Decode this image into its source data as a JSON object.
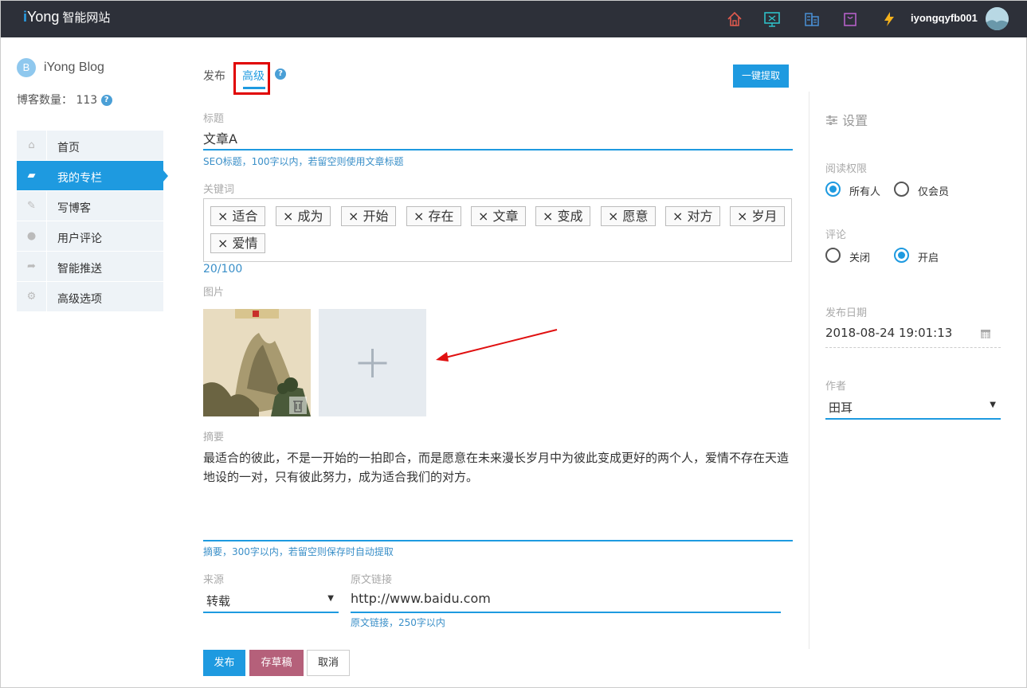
{
  "app": {
    "logo_i": "i",
    "logo_yong": "Yong",
    "logo_sub": "智能网站",
    "username": "iyongqyfb001"
  },
  "blog": {
    "initial": "B",
    "name": "iYong Blog",
    "count_label": "博客数量：",
    "count": "113"
  },
  "sidebar": {
    "items": [
      {
        "label": "首页",
        "icon": "home-icon"
      },
      {
        "label": "我的专栏",
        "icon": "folder-icon"
      },
      {
        "label": "写博客",
        "icon": "edit-icon"
      },
      {
        "label": "用户评论",
        "icon": "comment-icon"
      },
      {
        "label": "智能推送",
        "icon": "share-icon"
      },
      {
        "label": "高级选项",
        "icon": "gears-icon"
      }
    ]
  },
  "tabs": {
    "publish": "发布",
    "advanced": "高级",
    "extract_button": "一键提取"
  },
  "form": {
    "title_label": "标题",
    "title_value": "文章A",
    "title_hint": "SEO标题，100字以内，若留空则使用文章标题",
    "keywords_label": "关键词",
    "keywords": [
      "适合",
      "成为",
      "开始",
      "存在",
      "文章",
      "变成",
      "愿意",
      "对方",
      "岁月",
      "爱情"
    ],
    "keywords_count": "20/100",
    "image_label": "图片",
    "summary_label": "摘要",
    "summary_value": "最适合的彼此，不是一开始的一拍即合，而是愿意在未来漫长岁月中为彼此变成更好的两个人，爱情不存在天造地设的一对，只有彼此努力，成为适合我们的对方。",
    "summary_hint": "摘要，300字以内，若留空则保存时自动提取",
    "source_label": "来源",
    "source_value": "转载",
    "link_label": "原文链接",
    "link_value": "http://www.baidu.com",
    "link_hint": "原文链接，250字以内"
  },
  "buttons": {
    "publish": "发布",
    "draft": "存草稿",
    "cancel": "取消"
  },
  "settings": {
    "title": "设置",
    "read_label": "阅读权限",
    "read_all": "所有人",
    "read_member": "仅会员",
    "comment_label": "评论",
    "comment_off": "关闭",
    "comment_on": "开启",
    "date_label": "发布日期",
    "date_value": "2018-08-24 19:01:13",
    "author_label": "作者",
    "author_value": "田耳"
  },
  "colors": {
    "accent": "#1e9ae0",
    "draft": "#b5607a",
    "topbar": "#2d3039"
  }
}
